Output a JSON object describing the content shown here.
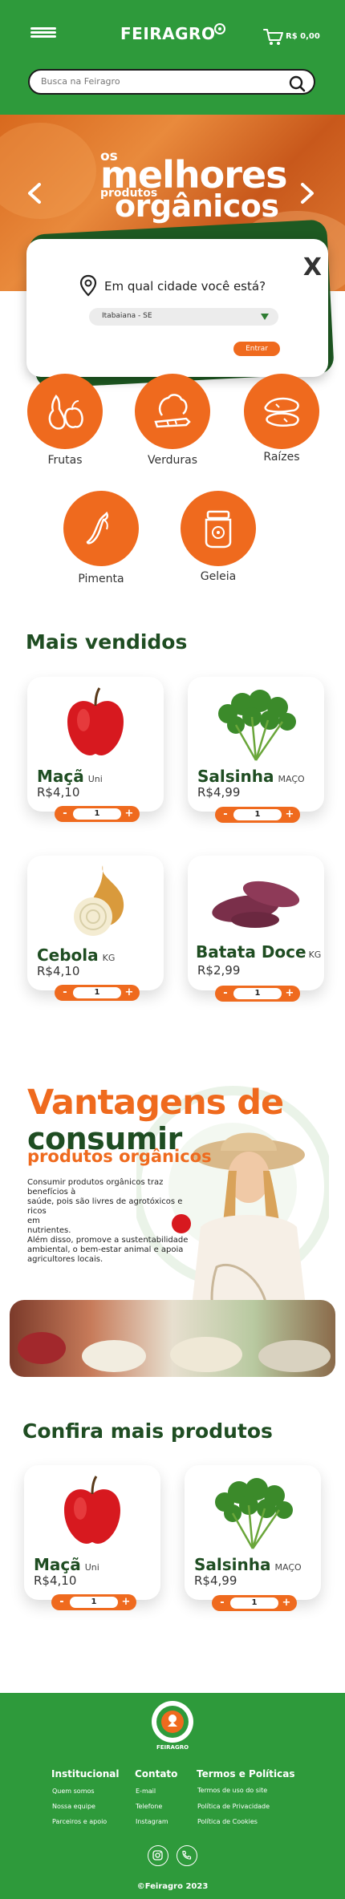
{
  "header": {
    "logo": "FEIRAGRO",
    "cart_total": "R$ 0,00",
    "search_placeholder": "Busca na Feiragro"
  },
  "hero": {
    "line_os": "os",
    "line_melhores": "melhores",
    "line_produtos": "produtos",
    "line_organicos": "orgânicos"
  },
  "city_modal": {
    "close": "X",
    "question": "Em qual cidade você está?",
    "selected_city": "Itabaiana - SE",
    "enter_label": "Entrar"
  },
  "categories": [
    {
      "label": "Frutas",
      "icon": "pear-apple-icon"
    },
    {
      "label": "Verduras",
      "icon": "vegetables-icon"
    },
    {
      "label": "Raízes",
      "icon": "sweet-potato-icon"
    },
    {
      "label": "Pimenta",
      "icon": "pepper-icon"
    },
    {
      "label": "Geleia",
      "icon": "jam-jar-icon"
    }
  ],
  "best_sellers": {
    "title": "Mais vendidos",
    "products": [
      {
        "name": "Maçã",
        "unit": "Uni",
        "price": "R$4,10",
        "qty": "1"
      },
      {
        "name": "Salsinha",
        "unit": "MAÇO",
        "price": "R$4,99",
        "qty": "1"
      },
      {
        "name": "Cebola",
        "unit": "KG",
        "price": "R$4,10",
        "qty": "1"
      },
      {
        "name": "Batata Doce",
        "unit": "KG",
        "price": "R$2,99",
        "qty": "1"
      }
    ]
  },
  "stepper": {
    "minus": "-",
    "plus": "+"
  },
  "advantages": {
    "title_line1": "Vantagens de",
    "title_line2": "consumir",
    "title_line3": "produtos orgânicos",
    "paragraph1": [
      "Consumir produtos orgânicos traz",
      "benefícios à",
      "saúde, pois são livres de agrotóxicos e ricos",
      "em",
      "nutrientes."
    ],
    "paragraph2": [
      "Além disso, promove a sustentabilidade",
      "ambiental, o bem-estar animal e apoia",
      "agricultores locais."
    ]
  },
  "more_products": {
    "title": "Confira mais produtos",
    "products": [
      {
        "name": "Maçã",
        "unit": "Uni",
        "price": "R$4,10",
        "qty": "1"
      },
      {
        "name": "Salsinha",
        "unit": "MAÇO",
        "price": "R$4,99",
        "qty": "1"
      }
    ]
  },
  "footer": {
    "logo_text": "FEIRAGRO",
    "columns": [
      {
        "title": "Institucional",
        "links": [
          "Quem somos",
          "Nossa equipe",
          "Parceiros e apoio"
        ]
      },
      {
        "title": "Contato",
        "links": [
          "E-mail",
          "Telefone",
          "Instagram"
        ]
      },
      {
        "title": "Termos e Políticas",
        "links": [
          "Termos de uso do site",
          "Política de Privacidade",
          "Política de Cookies"
        ]
      }
    ],
    "social_icons": [
      "instagram-icon",
      "phone-icon"
    ],
    "copyright": "©Feiragro 2023"
  },
  "colors": {
    "green": "#2e9a3b",
    "dark_green": "#1f4d22",
    "orange": "#ef6a1e"
  }
}
